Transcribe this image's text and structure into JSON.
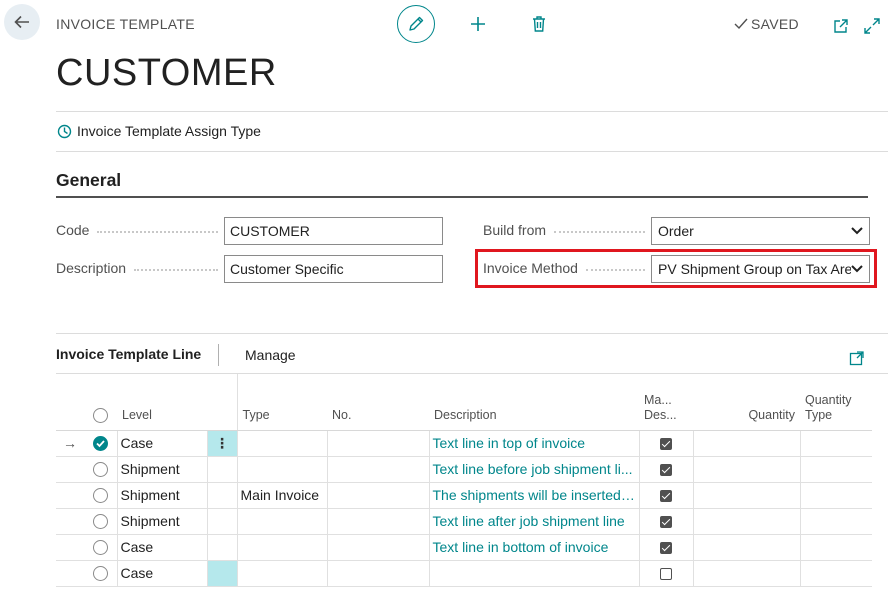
{
  "header": {
    "caption": "INVOICE TEMPLATE",
    "saved_label": "SAVED",
    "title": "CUSTOMER"
  },
  "actions": {
    "assign_type": "Invoice Template Assign Type"
  },
  "general": {
    "section_title": "General",
    "code": {
      "label": "Code",
      "value": "CUSTOMER"
    },
    "description": {
      "label": "Description",
      "value": "Customer Specific"
    },
    "build_from": {
      "label": "Build from",
      "value": "Order"
    },
    "invoice_method": {
      "label": "Invoice Method",
      "value": "PV Shipment Group on Tax Are"
    }
  },
  "lines_part": {
    "title": "Invoice Template Line",
    "manage_label": "Manage",
    "columns": {
      "level": "Level",
      "type": "Type",
      "no": "No.",
      "description": "Description",
      "mandatory_desc_1": "Ma...",
      "mandatory_desc_2": "Des...",
      "quantity": "Quantity",
      "quantity_type_1": "Quantity",
      "quantity_type_2": "Type"
    },
    "rows": [
      {
        "level": "Case",
        "type": "",
        "no": "",
        "description": "Text line in top of invoice",
        "mandatory": true,
        "quantity": "",
        "quantity_type": "",
        "selected": true,
        "current": true
      },
      {
        "level": "Shipment",
        "type": "",
        "no": "",
        "description": "Text line before job shipment li...",
        "mandatory": true,
        "quantity": "",
        "quantity_type": "",
        "selected": false,
        "current": false
      },
      {
        "level": "Shipment",
        "type": "Main Invoice",
        "no": "",
        "description": "The shipments will be inserted ...",
        "mandatory": true,
        "quantity": "",
        "quantity_type": "",
        "selected": false,
        "current": false
      },
      {
        "level": "Shipment",
        "type": "",
        "no": "",
        "description": "Text line after job shipment line",
        "mandatory": true,
        "quantity": "",
        "quantity_type": "",
        "selected": false,
        "current": false
      },
      {
        "level": "Case",
        "type": "",
        "no": "",
        "description": "Text line in bottom of invoice",
        "mandatory": true,
        "quantity": "",
        "quantity_type": "",
        "selected": false,
        "current": false
      },
      {
        "level": "Case",
        "type": "",
        "no": "",
        "description": "",
        "mandatory": false,
        "quantity": "",
        "quantity_type": "",
        "selected": false,
        "current": false
      }
    ]
  },
  "colors": {
    "accent": "#00868b",
    "highlight": "#e0171f",
    "teal_cell": "#b5e8ec"
  }
}
